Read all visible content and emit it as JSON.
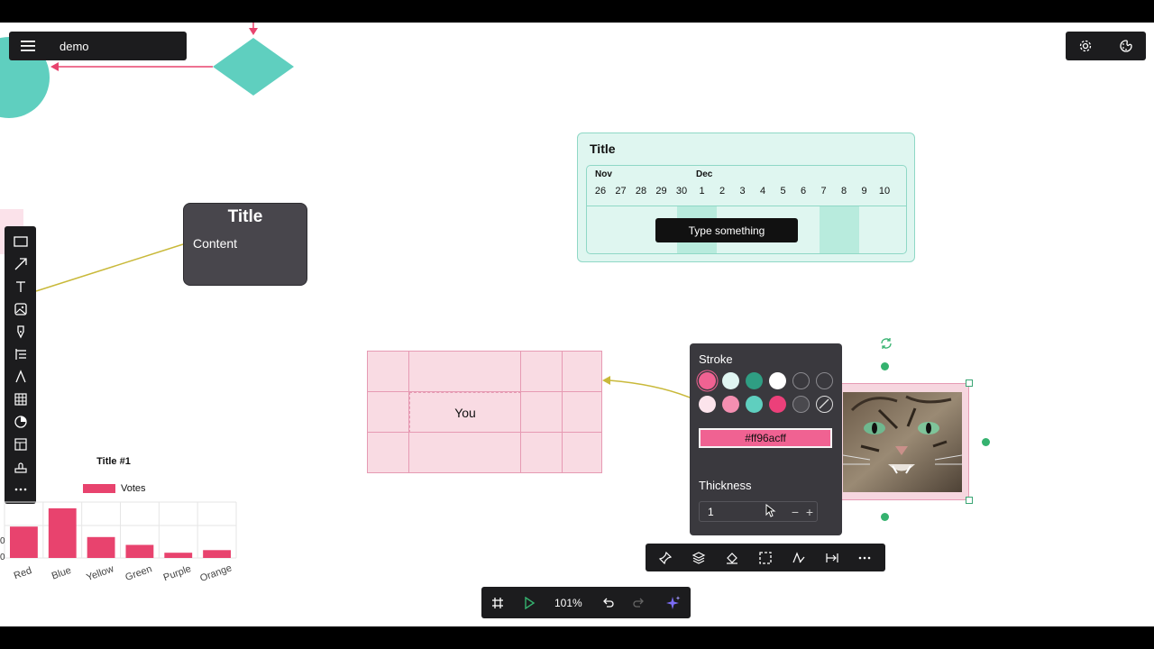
{
  "app": {
    "doc_name": "demo"
  },
  "note": {
    "title": "Title",
    "content": "Content"
  },
  "timeline": {
    "title": "Title",
    "months": [
      {
        "label": "Nov"
      },
      {
        "label": "Dec"
      }
    ],
    "days": [
      "26",
      "27",
      "28",
      "29",
      "30",
      "1",
      "2",
      "3",
      "4",
      "5",
      "6",
      "7",
      "8",
      "9",
      "10"
    ],
    "button_label": "Type something"
  },
  "table": {
    "cell_text": "You"
  },
  "stroke_panel": {
    "title": "Stroke",
    "colors_row1": [
      "#f06292",
      "#e0f5f2",
      "#2f9e83",
      "#ffffff",
      "#3a393e",
      "#3a393e"
    ],
    "colors_row2": [
      "#fce4ec",
      "#f48fb1",
      "#5fcfbf",
      "#ec407a",
      "#4a494e",
      "none"
    ],
    "hex_value": "#ff96acff",
    "thickness_label": "Thickness",
    "thickness_value": "1",
    "minus": "−",
    "plus": "+"
  },
  "bottom_bar": {
    "zoom": "101%"
  },
  "chart_data": {
    "type": "bar",
    "title": "Title #1",
    "categories": [
      "Red",
      "Blue",
      "Yellow",
      "Green",
      "Purple",
      "Orange"
    ],
    "series": [
      {
        "name": "Votes",
        "values": [
          12,
          19,
          8,
          5,
          2,
          3
        ]
      }
    ],
    "ylim": [
      0,
      20
    ],
    "legend": "top",
    "color": "#e8436e",
    "y_tick_labels": [
      "0",
      "0"
    ]
  },
  "colors": {
    "accent_pink": "#f06292",
    "teal": "#5fcfbf",
    "toolbar_bg": "#1c1c1e"
  }
}
